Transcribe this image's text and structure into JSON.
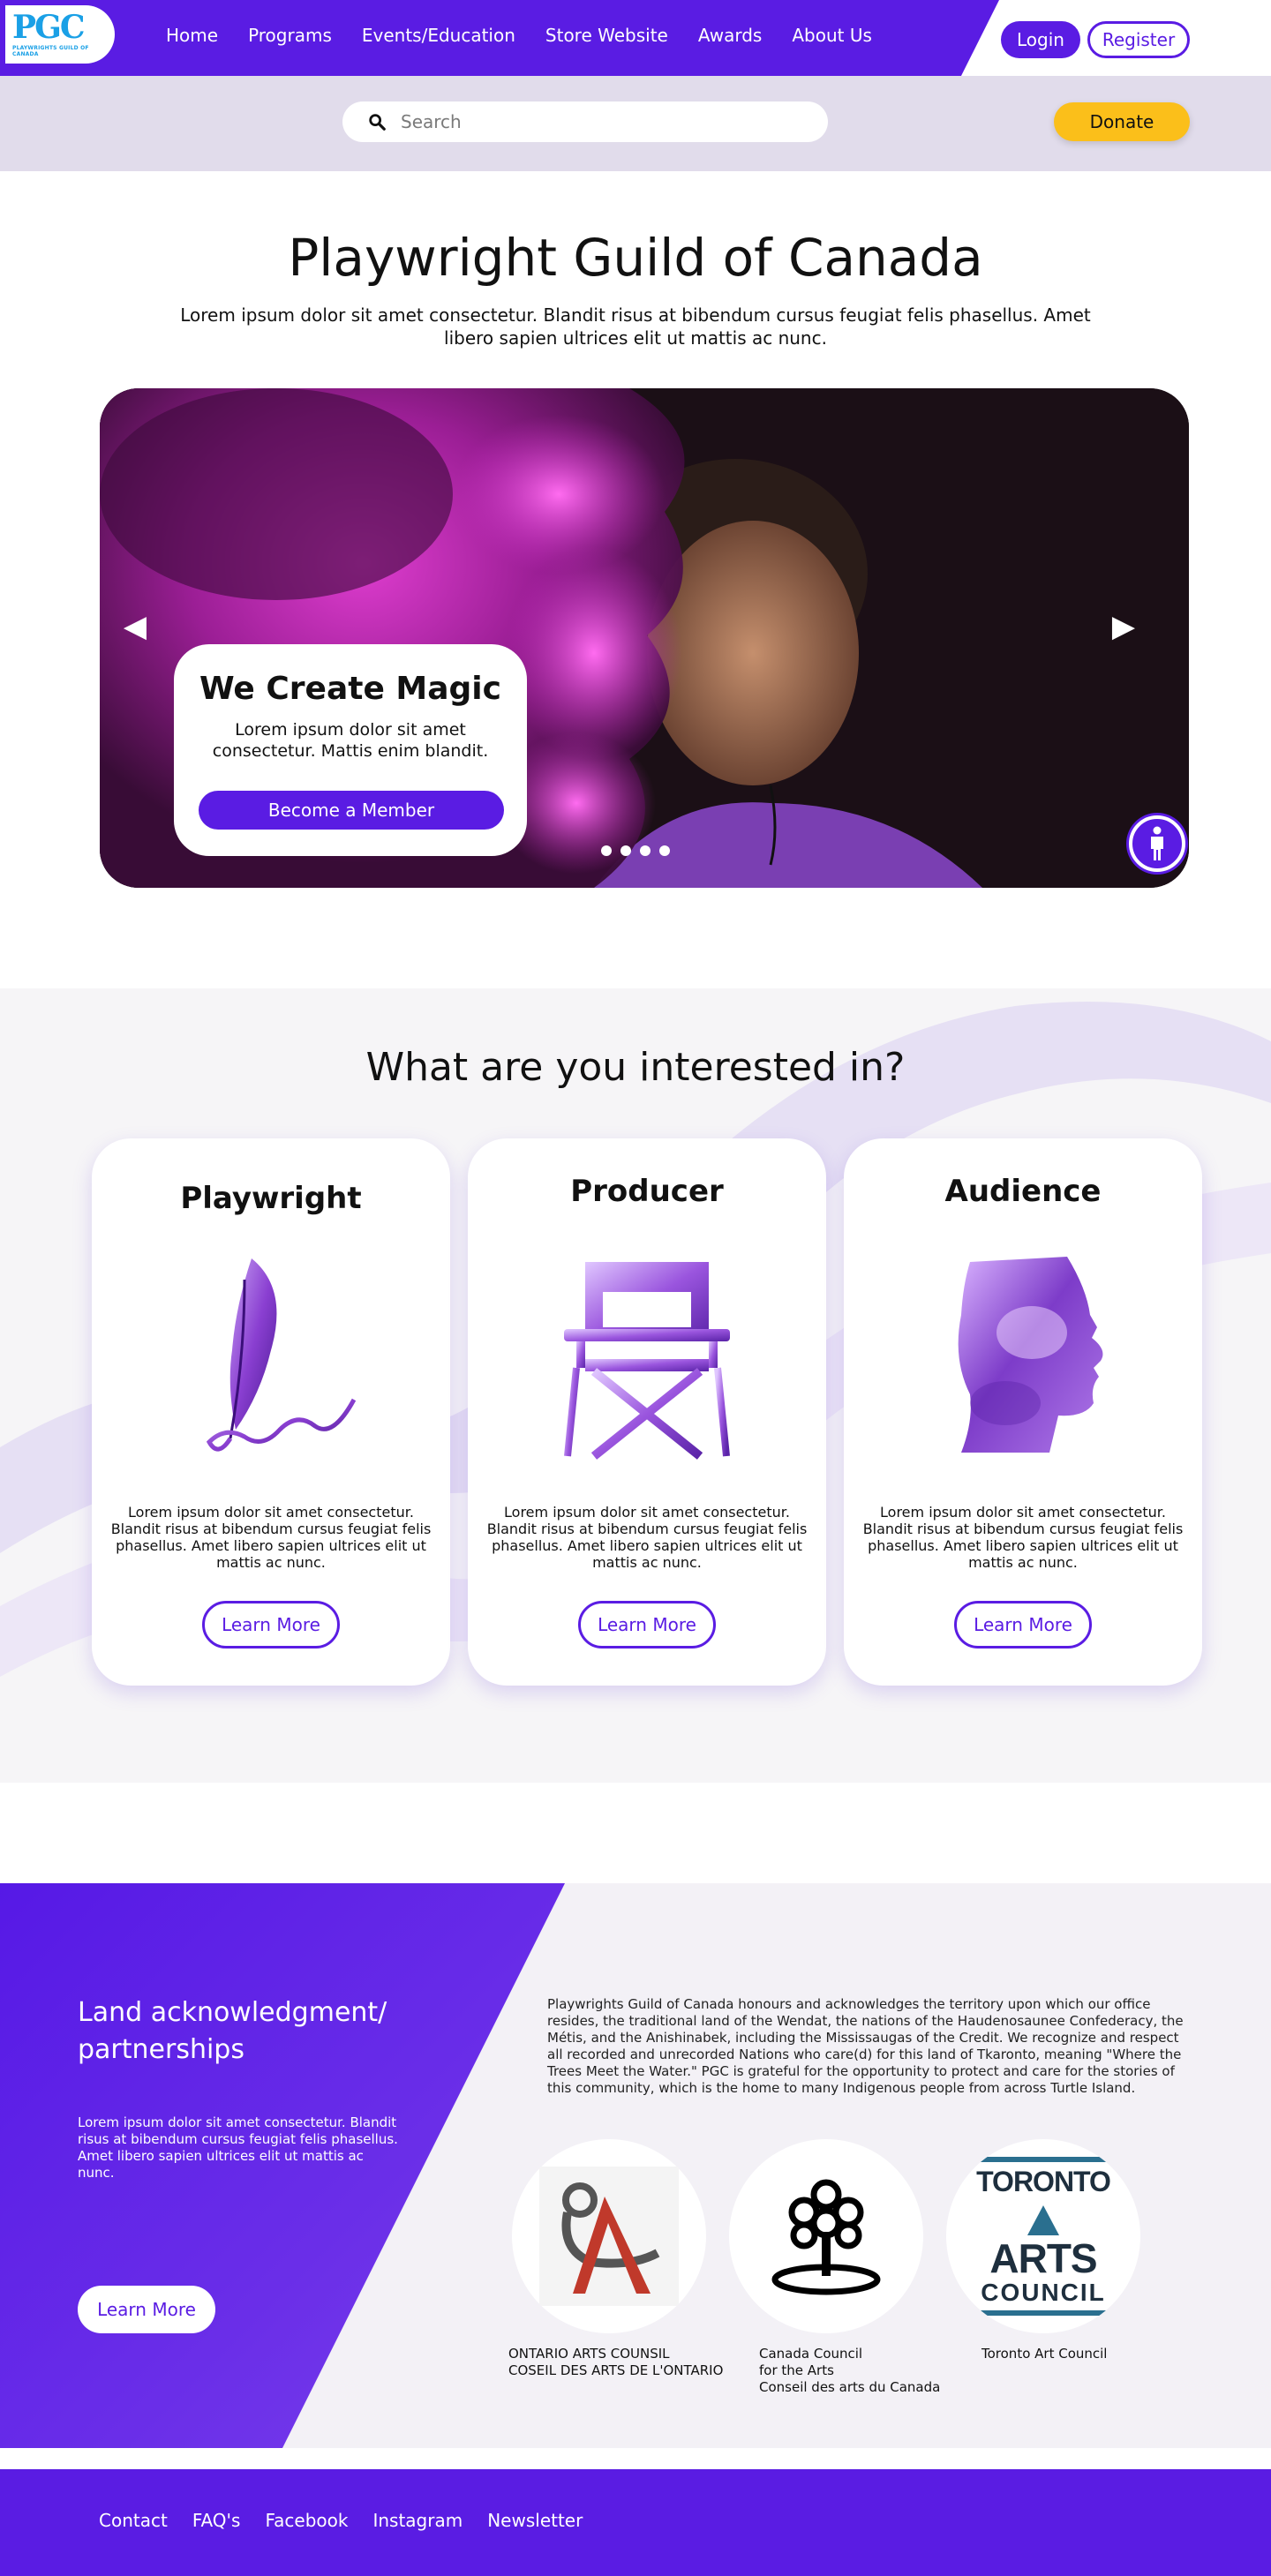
{
  "header": {
    "logo_text": "PGC",
    "logo_subtext": "PLAYWRIGHTS GUILD OF CANADA",
    "nav": [
      "Home",
      "Programs",
      "Events/Education",
      "Store Website",
      "Awards",
      "About Us"
    ],
    "login_label": "Login",
    "register_label": "Register"
  },
  "search": {
    "placeholder": "Search",
    "value": ""
  },
  "donate_label": "Donate",
  "hero": {
    "title": "Playwright Guild of Canada",
    "description": "Lorem ipsum dolor sit amet consectetur. Blandit risus at bibendum cursus feugiat felis phasellus. Amet libero sapien ultrices elit ut mattis ac nunc."
  },
  "carousel": {
    "prev_icon": "◀",
    "next_icon": "▶",
    "slide_title": "We Create Magic",
    "slide_text": "Lorem ipsum dolor sit amet consectetur. Mattis enim blandit.",
    "cta_label": "Become a Member",
    "slide_count": 4
  },
  "interests": {
    "heading": "What are you interested in?",
    "cards": [
      {
        "title": "Playwright",
        "icon": "quill-pen-icon",
        "text": "Lorem ipsum dolor sit amet consectetur. Blandit risus at bibendum cursus feugiat felis phasellus. Amet libero sapien ultrices elit ut mattis ac nunc.",
        "button": "Learn More"
      },
      {
        "title": "Producer",
        "icon": "director-chair-icon",
        "text": "Lorem ipsum dolor sit amet consectetur. Blandit risus at bibendum cursus feugiat felis phasellus. Amet libero sapien ultrices elit ut mattis ac nunc.",
        "button": "Learn More"
      },
      {
        "title": "Audience",
        "icon": "human-profile-icon",
        "text": "Lorem ipsum dolor sit amet consectetur. Blandit risus at bibendum cursus feugiat felis phasellus. Amet libero sapien ultrices elit ut mattis ac nunc.",
        "button": "Learn More"
      }
    ]
  },
  "land": {
    "heading": "Land acknowledgment/ partnerships",
    "text": "Lorem ipsum dolor sit amet consectetur. Blandit risus at bibendum cursus feugiat felis phasellus. Amet libero sapien ultrices elit ut mattis ac nunc.",
    "button": "Learn More",
    "acknowledgment": "Playwrights Guild of Canada honours and acknowledges the territory upon which our office resides, the traditional land of the Wendat, the nations of the Haudenosaunee Confederacy, the Métis, and the Anishinabek, including the Mississaugas of the Credit. We recognize and respect all recorded and unrecorded Nations who care(d) for this land of Tkaronto, meaning \"Where the Trees Meet the Water.\" PGC is grateful for the opportunity to protect and care for the stories of this community, which is the home to many Indigenous people from across Turtle Island.",
    "partners": [
      {
        "line1": "ONTARIO ARTS COUNSIL",
        "line2": "COSEIL DES ARTS DE L'ONTARIO",
        "line3": ""
      },
      {
        "line1": "Canada Council",
        "line2": "for the Arts",
        "line3": "Conseil des arts du Canada"
      },
      {
        "line1": "Toronto Art Council",
        "line2": "",
        "line3": ""
      }
    ],
    "toronto_logo": {
      "line1": "TORONTO",
      "line2": "ARTS",
      "line3": "COUNCIL"
    }
  },
  "footer": {
    "links": [
      "Contact",
      "FAQ's",
      "Facebook",
      "Instagram",
      "Newsletter"
    ]
  },
  "colors": {
    "brand_purple": "#5a1ce3",
    "donate_yellow": "#fbbf1a",
    "logo_blue": "#1aa0e6",
    "search_band": "#e1dceb"
  }
}
